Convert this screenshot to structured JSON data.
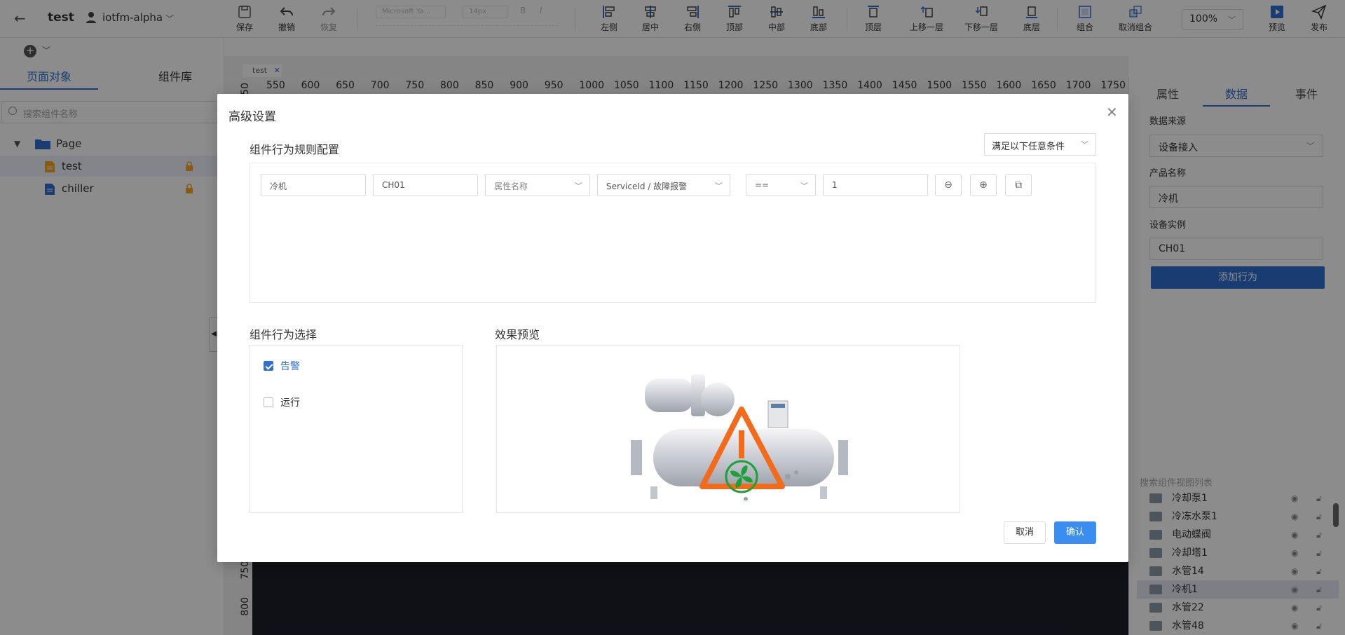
{
  "app": {
    "title": "test",
    "user": "iotfm-alpha"
  },
  "toolbar": {
    "save": "保存",
    "undo": "撤销",
    "redo": "恢复",
    "font_placeholder": "Microsoft Ya...",
    "size_placeholder": "14px",
    "align_left": "左侧",
    "align_center": "居中",
    "align_right": "右侧",
    "align_top": "顶部",
    "align_middle": "中部",
    "align_bottom": "底部",
    "bring_front": "顶层",
    "move_up": "上移一层",
    "move_down": "下移一层",
    "send_back": "底层",
    "group": "组合",
    "ungroup": "取消组合",
    "zoom": "100%",
    "preview": "预览",
    "publish": "发布"
  },
  "left": {
    "tab_objects": "页面对象",
    "tab_library": "组件库",
    "search_placeholder": "搜索组件名称",
    "tree": [
      {
        "label": "Page"
      },
      {
        "label": "test"
      },
      {
        "label": "chiller"
      }
    ]
  },
  "canvas": {
    "tab": "test",
    "ruler_h": [
      "550",
      "600",
      "650",
      "700",
      "750",
      "800",
      "850",
      "900",
      "950",
      "1000",
      "1050",
      "1100",
      "1150",
      "1200",
      "1250",
      "1300",
      "1350",
      "1400",
      "1450",
      "1500",
      "1550",
      "1600",
      "1650",
      "1700",
      "1750"
    ],
    "ruler_v": [
      "50",
      "750",
      "800"
    ]
  },
  "right": {
    "tab_props": "属性",
    "tab_data": "数据",
    "tab_events": "事件",
    "source_label": "数据来源",
    "source_value": "设备接入",
    "product_label": "产品名称",
    "product_value": "冷机",
    "instance_label": "设备实例",
    "instance_value": "CH01",
    "add_behavior": "添加行为",
    "layer_search": "搜索组件视图列表",
    "layers": [
      {
        "label": "冷却泵1"
      },
      {
        "label": "冷冻水泵1"
      },
      {
        "label": "电动蝶阀"
      },
      {
        "label": "冷却塔1"
      },
      {
        "label": "水管14"
      },
      {
        "label": "冷机1"
      },
      {
        "label": "水管22"
      },
      {
        "label": "水管48"
      }
    ]
  },
  "modal": {
    "title": "高级设置",
    "rule_section": "组件行为规则配置",
    "condition_mode": "满足以下任意条件",
    "rule": {
      "product": "冷机",
      "device": "CH01",
      "attr_placeholder": "属性名称",
      "service": "ServiceId / 故障报警",
      "operator": "==",
      "value": "1"
    },
    "behavior_section": "组件行为选择",
    "behaviors": [
      {
        "label": "告警",
        "checked": true
      },
      {
        "label": "运行",
        "checked": false
      }
    ],
    "preview_section": "效果预览",
    "cancel": "取消",
    "confirm": "确认"
  }
}
